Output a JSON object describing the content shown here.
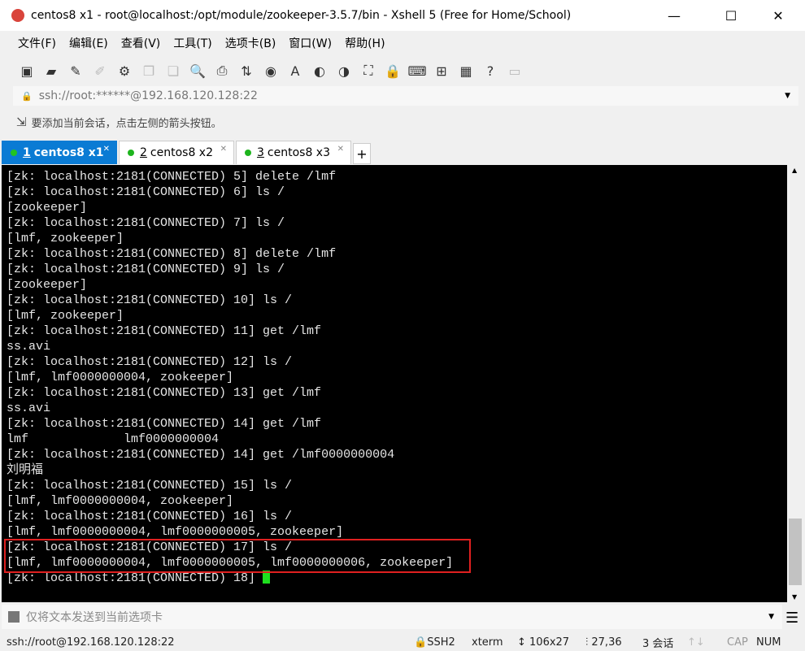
{
  "window": {
    "title": "centos8 x1 - root@localhost:/opt/module/zookeeper-3.5.7/bin - Xshell 5 (Free for Home/School)",
    "minimize": "—",
    "maximize": "☐",
    "close": "✕"
  },
  "menu": [
    "文件(F)",
    "编辑(E)",
    "查看(V)",
    "工具(T)",
    "选项卡(B)",
    "窗口(W)",
    "帮助(H)"
  ],
  "toolbar": [
    {
      "icon": "new-session-icon",
      "glyph": "▣"
    },
    {
      "icon": "open-folder-icon",
      "glyph": "▰"
    },
    {
      "icon": "connect-icon",
      "glyph": "✎"
    },
    {
      "icon": "disconnect-icon",
      "glyph": "✐",
      "disabled": true
    },
    {
      "icon": "properties-icon",
      "glyph": "⚙"
    },
    {
      "icon": "copy-icon",
      "glyph": "❐",
      "disabled": true
    },
    {
      "icon": "paste-icon",
      "glyph": "❏",
      "disabled": true
    },
    {
      "icon": "find-icon",
      "glyph": "🔍"
    },
    {
      "icon": "print-icon",
      "glyph": "⎙"
    },
    {
      "icon": "transfer-icon",
      "glyph": "⇅"
    },
    {
      "icon": "globe-icon",
      "glyph": "◉"
    },
    {
      "icon": "font-icon",
      "glyph": "A"
    },
    {
      "icon": "xftp-icon",
      "glyph": "◐"
    },
    {
      "icon": "xmanager-icon",
      "glyph": "◑"
    },
    {
      "icon": "fullscreen-icon",
      "glyph": "⛶"
    },
    {
      "icon": "lock-icon",
      "glyph": "🔒"
    },
    {
      "icon": "keyboard-icon",
      "glyph": "⌨"
    },
    {
      "icon": "new-tab-icon",
      "glyph": "⊞"
    },
    {
      "icon": "layout-icon",
      "glyph": "▦"
    },
    {
      "icon": "help-icon",
      "glyph": "?"
    },
    {
      "icon": "chat-icon",
      "glyph": "▭",
      "disabled": true
    }
  ],
  "address": "ssh://root:******@192.168.120.128:22",
  "hint": "要添加当前会话，点击左侧的箭头按钮。",
  "tabs": [
    {
      "num": "1",
      "label": "centos8 x1",
      "active": true
    },
    {
      "num": "2",
      "label": "centos8 x2"
    },
    {
      "num": "3",
      "label": "centos8 x3"
    }
  ],
  "terminal": {
    "lines": [
      "[zk: localhost:2181(CONNECTED) 5] delete /lmf",
      "[zk: localhost:2181(CONNECTED) 6] ls /",
      "[zookeeper]",
      "[zk: localhost:2181(CONNECTED) 7] ls /",
      "[lmf, zookeeper]",
      "[zk: localhost:2181(CONNECTED) 8] delete /lmf",
      "[zk: localhost:2181(CONNECTED) 9] ls /",
      "[zookeeper]",
      "[zk: localhost:2181(CONNECTED) 10] ls /",
      "[lmf, zookeeper]",
      "[zk: localhost:2181(CONNECTED) 11] get /lmf",
      "ss.avi",
      "[zk: localhost:2181(CONNECTED) 12] ls /",
      "[lmf, lmf0000000004, zookeeper]",
      "[zk: localhost:2181(CONNECTED) 13] get /lmf",
      "ss.avi",
      "[zk: localhost:2181(CONNECTED) 14] get /lmf",
      "lmf             lmf0000000004",
      "[zk: localhost:2181(CONNECTED) 14] get /lmf0000000004",
      "刘明福",
      "[zk: localhost:2181(CONNECTED) 15] ls /",
      "[lmf, lmf0000000004, zookeeper]",
      "[zk: localhost:2181(CONNECTED) 16] ls /",
      "[lmf, lmf0000000004, lmf0000000005, zookeeper]",
      "[zk: localhost:2181(CONNECTED) 17] ls /",
      "[lmf, lmf0000000004, lmf0000000005, lmf0000000006, zookeeper]"
    ],
    "prompt": "[zk: localhost:2181(CONNECTED) 18] "
  },
  "sendbar": "仅将文本发送到当前选项卡",
  "status": {
    "connection": "ssh://root@192.168.120.128:22",
    "protocol": "SSH2",
    "term": "xterm",
    "size": "106x27",
    "cursor": "27,36",
    "sessions": "3 会话",
    "cap": "CAP",
    "num": "NUM"
  }
}
